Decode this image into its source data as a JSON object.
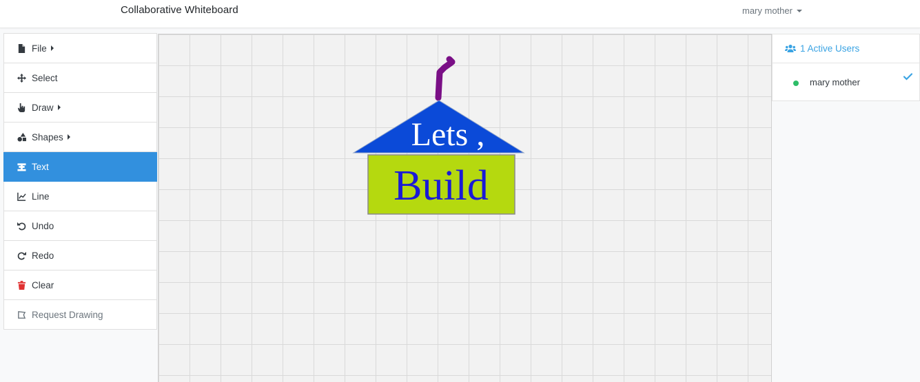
{
  "navbar": {
    "title": "Collaborative Whiteboard",
    "user": "mary mother"
  },
  "toolbar": {
    "items": [
      {
        "label": "File",
        "icon": "file-icon",
        "submenu": true
      },
      {
        "label": "Select",
        "icon": "move-icon",
        "submenu": false
      },
      {
        "label": "Draw",
        "icon": "hand-pointer-icon",
        "submenu": true
      },
      {
        "label": "Shapes",
        "icon": "shapes-icon",
        "submenu": true
      },
      {
        "label": "Text",
        "icon": "text-icon",
        "submenu": false,
        "active": true
      },
      {
        "label": "Line",
        "icon": "line-chart-icon",
        "submenu": false
      },
      {
        "label": "Undo",
        "icon": "undo-icon",
        "submenu": false
      },
      {
        "label": "Redo",
        "icon": "redo-icon",
        "submenu": false
      },
      {
        "label": "Clear",
        "icon": "trash-icon",
        "submenu": false
      },
      {
        "label": "Request Drawing",
        "icon": "request-icon",
        "submenu": false
      }
    ]
  },
  "canvas": {
    "roof_text": "Lets ,",
    "box_text": "Build",
    "colors": {
      "roof": "#0b4ad8",
      "box": "#b5d90f",
      "box_text": "#1a1ad6",
      "stroke": "#7a0f86",
      "grid": "#d9d9d9",
      "background": "#f2f2f2"
    }
  },
  "users_panel": {
    "header": "1 Active Users",
    "users": [
      {
        "name": "mary mother",
        "status_color": "#2ebd68"
      }
    ]
  },
  "colors": {
    "accent": "#3290de",
    "users_header": "#3aa3e3",
    "clear_icon": "#e03131"
  }
}
